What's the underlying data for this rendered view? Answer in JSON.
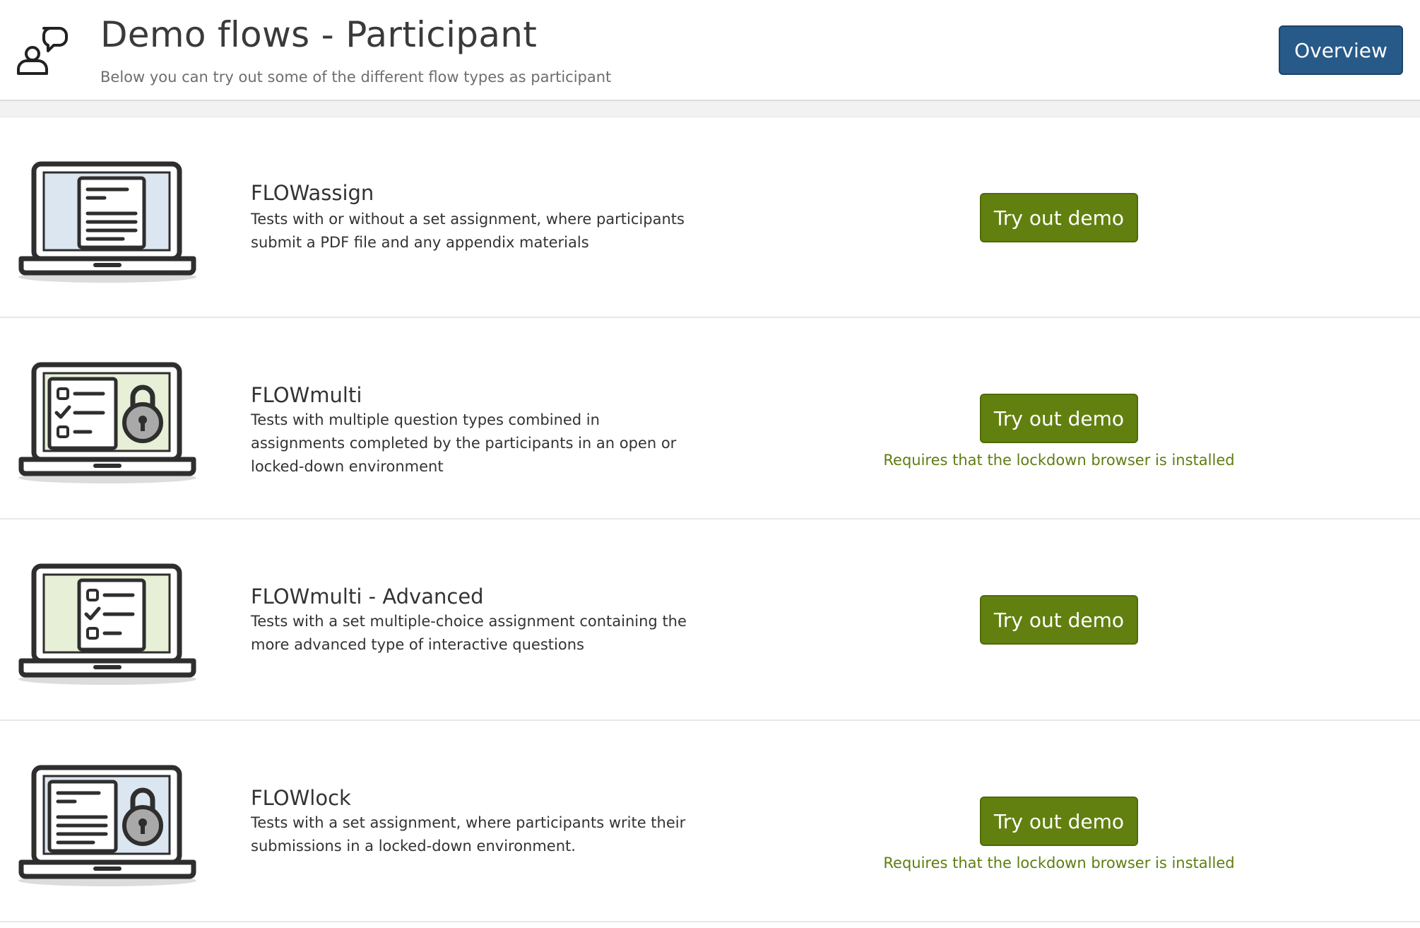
{
  "header": {
    "title": "Demo flows - Participant",
    "subtitle": "Below you can try out some of the different flow types as participant",
    "overview_label": "Overview",
    "icon": "participant-chat-icon"
  },
  "colors": {
    "primary_blue": "#275a88",
    "demo_green": "#62800f",
    "note_green": "#5e7d10",
    "screen_blue": "#dbe6f0",
    "screen_green": "#e7f0d6"
  },
  "flows": [
    {
      "title": "FLOWassign",
      "description": "Tests with or without a set assignment, where participants submit a PDF file and any appendix materials",
      "button_label": "Try out demo",
      "note": "",
      "icon": "laptop-document-icon"
    },
    {
      "title": "FLOWmulti",
      "description": "Tests with multiple question types combined in assignments completed by the participants in an open or locked-down environment",
      "button_label": "Try out demo",
      "note": "Requires that the lockdown browser is installed",
      "icon": "laptop-checklist-lock-icon"
    },
    {
      "title": "FLOWmulti - Advanced",
      "description": "Tests with a set multiple-choice assignment containing the more advanced type of interactive questions",
      "button_label": "Try out demo",
      "note": "",
      "icon": "laptop-checklist-icon"
    },
    {
      "title": "FLOWlock",
      "description": "Tests with a set assignment, where participants write their submissions in a locked-down environment.",
      "button_label": "Try out demo",
      "note": "Requires that the lockdown browser is installed",
      "icon": "laptop-document-lock-icon"
    }
  ]
}
